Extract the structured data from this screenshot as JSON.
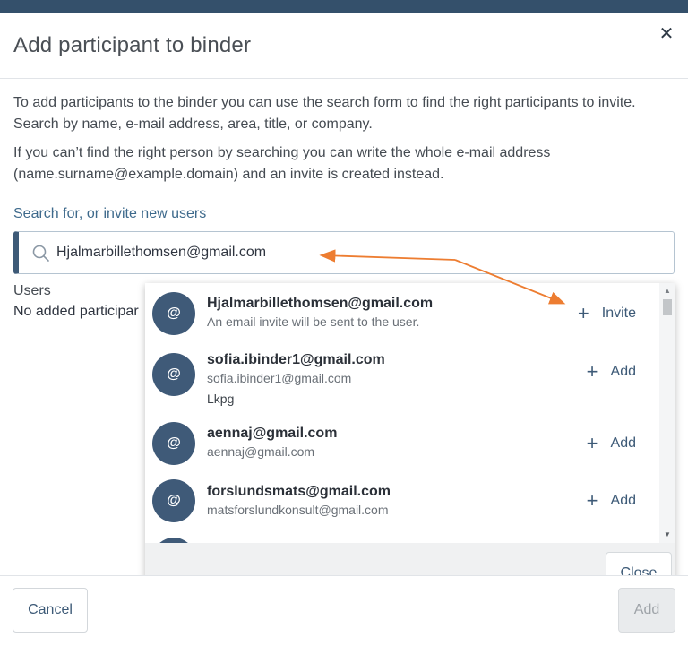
{
  "dialog": {
    "title": "Add participant to binder",
    "close_icon": "close-icon",
    "intro_1": "To add participants to the binder you can use the search form to find the right participants to invite. Search by name, e-mail address, area, title, or company.",
    "intro_2": "If you can’t find the right person by searching you can write the whole e-mail address (name.surname@example.domain) and an invite is created instead."
  },
  "search": {
    "label": "Search for, or invite new users",
    "value": "Hjalmarbillethomsen@gmail.com",
    "icon": "search-icon"
  },
  "users": {
    "label": "Users",
    "empty_text": "No added participar"
  },
  "results": [
    {
      "avatar": "@",
      "name": "Hjalmarbillethomsen@gmail.com",
      "sub": "An email invite will be sent to the user.",
      "extra": "",
      "action_icon": "plus-icon",
      "action": "Invite"
    },
    {
      "avatar": "@",
      "name": "sofia.ibinder1@gmail.com",
      "sub": "sofia.ibinder1@gmail.com",
      "extra": "Lkpg",
      "action_icon": "plus-icon",
      "action": "Add"
    },
    {
      "avatar": "@",
      "name": "aennaj@gmail.com",
      "sub": "aennaj@gmail.com",
      "extra": "",
      "action_icon": "plus-icon",
      "action": "Add"
    },
    {
      "avatar": "@",
      "name": "forslundsmats@gmail.com",
      "sub": "matsforslundkonsult@gmail.com",
      "extra": "",
      "action_icon": "plus-icon",
      "action": "Add"
    },
    {
      "avatar": "@",
      "name": "",
      "sub": "",
      "extra": "",
      "action_icon": "",
      "action": ""
    }
  ],
  "dropdown": {
    "close_label": "Close"
  },
  "footer": {
    "cancel_label": "Cancel",
    "add_label": "Add"
  },
  "colors": {
    "accent": "#3d5a77",
    "annotation": "#ed7d31",
    "topbar": "#34506b"
  }
}
